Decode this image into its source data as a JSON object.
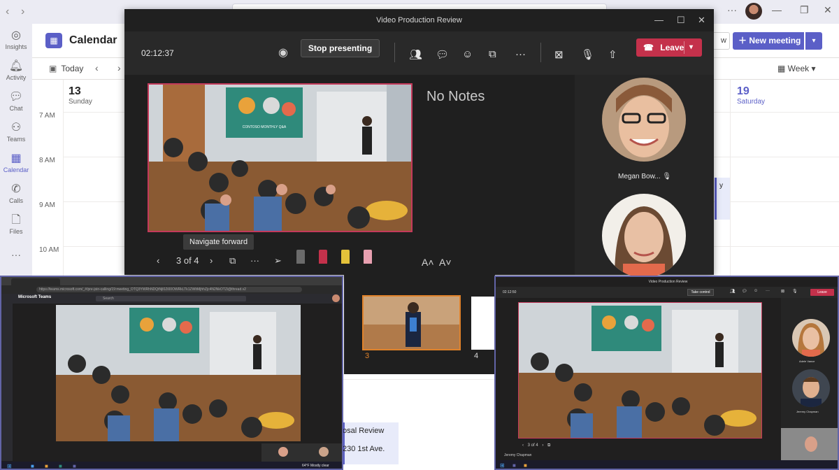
{
  "teams": {
    "app_title": "Calendar",
    "today_label": "Today",
    "view_label": "Week",
    "view_button_suffix": "w",
    "new_meeting_label": "New meeting",
    "rail": [
      {
        "label": "Insights",
        "icon": "insights-icon"
      },
      {
        "label": "Activity",
        "icon": "bell-icon"
      },
      {
        "label": "Chat",
        "icon": "chat-icon"
      },
      {
        "label": "Teams",
        "icon": "teams-icon"
      },
      {
        "label": "Calendar",
        "icon": "calendar-icon"
      },
      {
        "label": "Calls",
        "icon": "phone-icon"
      },
      {
        "label": "Files",
        "icon": "file-icon"
      }
    ],
    "days": [
      {
        "num": "13",
        "name": "Sunday"
      },
      {
        "num": "19",
        "name": "Saturday"
      }
    ],
    "times": [
      "7 AM",
      "8 AM",
      "9 AM",
      "10 AM"
    ],
    "event_partial_1": "y",
    "event_title_partial": "osal Review",
    "event_location_partial": "230 1st Ave."
  },
  "presenter_window": {
    "title": "Video Production Review",
    "timer": "02:12:37",
    "stop_presenting_label": "Stop presenting",
    "leave_label": "Leave",
    "notes_text": "No Notes",
    "slide_counter": "3 of 4",
    "tooltip": "Navigate forward",
    "slide_caption": "CONTOSO MONTHLY Q&A",
    "participants": [
      {
        "name": "Megan Bow...",
        "muted": true
      },
      {
        "name": "",
        "muted": false
      }
    ],
    "thumbnails": [
      {
        "num": "3",
        "selected": true
      },
      {
        "num": "4",
        "selected": false
      }
    ]
  },
  "attendee_left": {
    "url": "https://teams.microsoft.com/_#/pre-join-calling/19:meeting_OTQ3YWRhNDQtNjI0Zi00OWRkLTk1ZWItMjhhZjc4N2NkOTZi@thread.v2",
    "app_name": "Microsoft Teams",
    "search_placeholder": "Search",
    "weather": "64°F  Mostly clear"
  },
  "attendee_right": {
    "title": "Video Production Review",
    "timer": "02:12:50",
    "take_control_label": "Take control",
    "leave_label": "Leave",
    "slide_counter": "3 of 4",
    "presenter_label": "Jeremy Chapman",
    "participants": [
      {
        "name": "Adele Vance"
      },
      {
        "name": "Jeremy Chapman"
      }
    ]
  },
  "colors": {
    "teams_purple": "#5b5fc7",
    "leave_red": "#c4314b",
    "slide_border": "#c43a5b",
    "thumb_selected": "#e0822a"
  }
}
